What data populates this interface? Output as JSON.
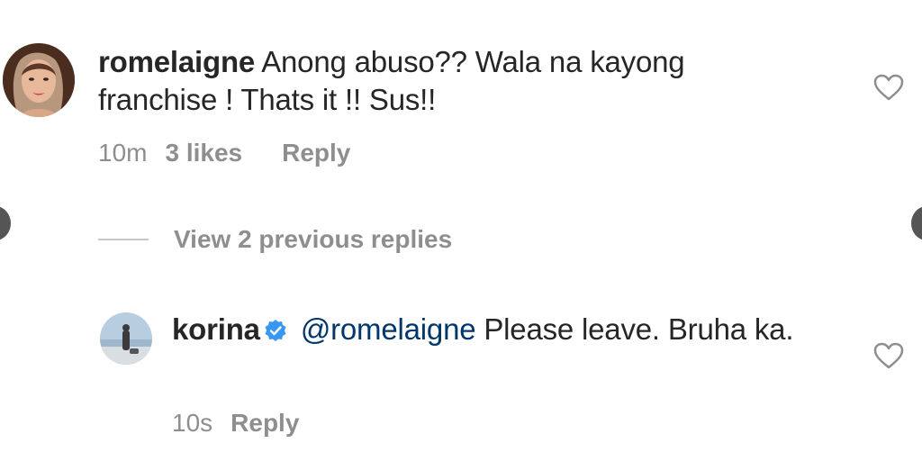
{
  "comment": {
    "username": "romelaigne",
    "text": "Anong abuso?? Wala na kayong franchise ! Thats it !! Sus!!",
    "time": "10m",
    "likes": "3 likes",
    "reply_label": "Reply"
  },
  "view_replies": {
    "label": "View 2 previous replies"
  },
  "reply": {
    "username": "korina",
    "mention": "@romelaigne",
    "text": "Please leave. Bruha ka.",
    "time": "10s",
    "reply_label": "Reply"
  },
  "icons": {
    "like": "heart-outline-icon",
    "verified": "verified-badge-icon",
    "nav_previous": "chevron-left-icon",
    "nav_next": "chevron-right-icon"
  },
  "colors": {
    "text": "#262626",
    "secondary": "#8e8e8e",
    "mention": "#00376b",
    "verified": "#3897f0"
  }
}
